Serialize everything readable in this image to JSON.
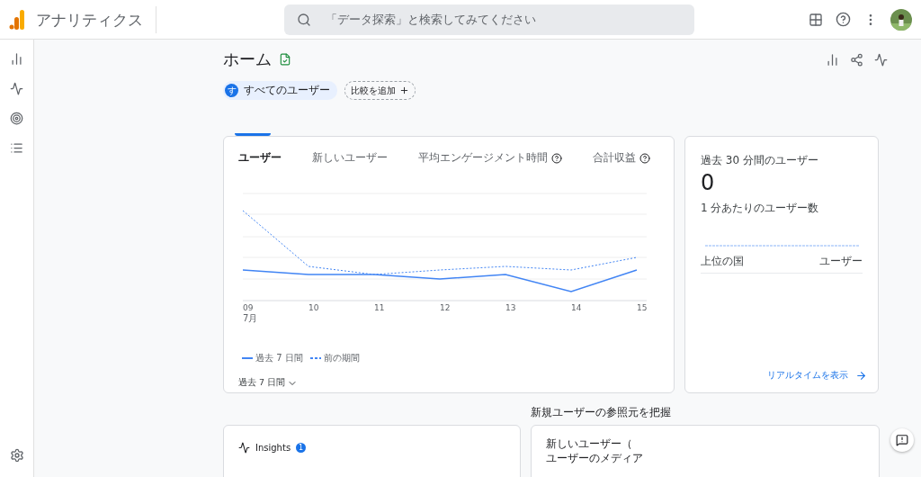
{
  "app": {
    "title": "アナリティクス"
  },
  "search": {
    "placeholder": "「データ探索」と検索してみてください"
  },
  "page": {
    "title": "ホーム",
    "segment": {
      "avatar": "す",
      "label": "すべてのユーザー"
    },
    "compare_button": "比較を追加"
  },
  "overview_card": {
    "tabs": [
      {
        "label": "ユーザー",
        "selected": true,
        "help": false
      },
      {
        "label": "新しいユーザー",
        "selected": false,
        "help": false
      },
      {
        "label": "平均エンゲージメント時間",
        "selected": false,
        "help": true
      },
      {
        "label": "合計収益",
        "selected": false,
        "help": true
      }
    ],
    "x_labels": [
      "09",
      "10",
      "11",
      "12",
      "13",
      "14",
      "15"
    ],
    "month": "7月",
    "legend": [
      {
        "label": "過去 7 日間",
        "kind": "solid"
      },
      {
        "label": "前の期間",
        "kind": "dashed"
      }
    ],
    "range": "過去 7 日間"
  },
  "realtime_card": {
    "title": "過去 30 分間のユーザー",
    "value": "0",
    "subtitle": "1 分あたりのユーザー数",
    "columns": [
      "上位の国",
      "ユーザー"
    ],
    "link": "リアルタイムを表示"
  },
  "insights": {
    "title": "Insights",
    "badge": "1"
  },
  "sources": {
    "heading": "新規ユーザーの参照元を把握",
    "lines": [
      "新しいユーザー（",
      "ユーザーのメディア"
    ]
  }
}
